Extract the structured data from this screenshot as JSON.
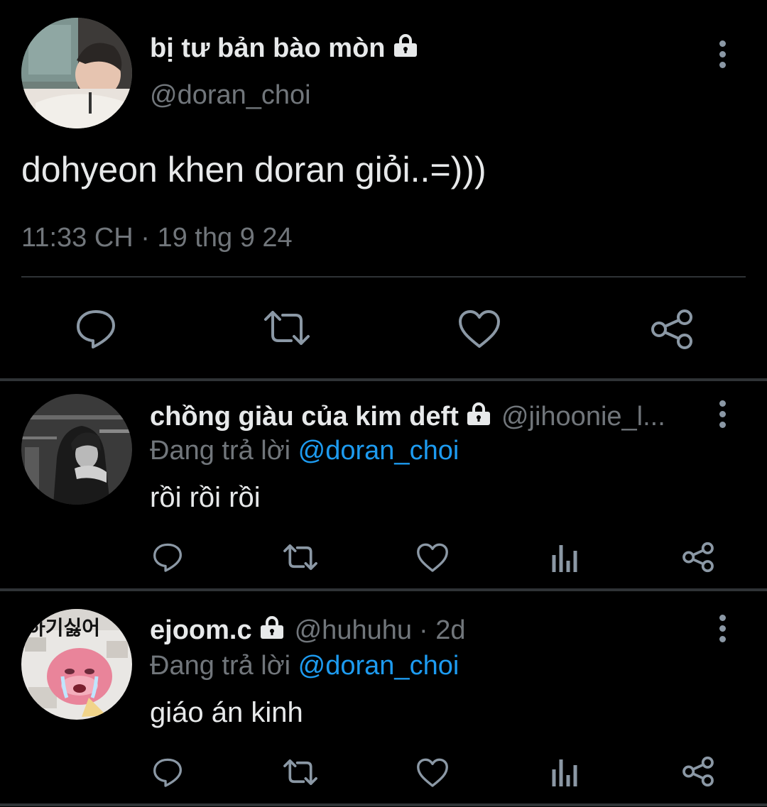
{
  "main_tweet": {
    "display_name": "bị tư bản bào mòn",
    "handle": "@doran_choi",
    "text": "dohyeon khen doran giỏi..=)))",
    "timestamp": "11:33 CH · 19 thg 9 24",
    "protected_icon": "lock-icon",
    "actions": [
      "reply-icon",
      "retweet-icon",
      "like-icon",
      "share-icon"
    ]
  },
  "replies": [
    {
      "display_name": "chồng giàu của kim deft",
      "handle": "@jihoonie_l...",
      "time": "",
      "replying_prefix": "Đang trả lời",
      "replying_to": "@doran_choi",
      "text": "rồi rồi rồi",
      "actions": [
        "reply-icon",
        "retweet-icon",
        "like-icon",
        "views-icon",
        "share-icon"
      ]
    },
    {
      "display_name": "ejoom.c",
      "handle": "@huhuhu",
      "time": "· 2d",
      "replying_prefix": "Đang trả lời",
      "replying_to": "@doran_choi",
      "text": "giáo án kinh",
      "avatar_text": "하기싫어",
      "actions": [
        "reply-icon",
        "retweet-icon",
        "like-icon",
        "views-icon",
        "share-icon"
      ]
    }
  ],
  "colors": {
    "background": "#000000",
    "text": "#e7e9ea",
    "muted": "#71767b",
    "link": "#1d9bf0",
    "divider": "#2f3336"
  }
}
